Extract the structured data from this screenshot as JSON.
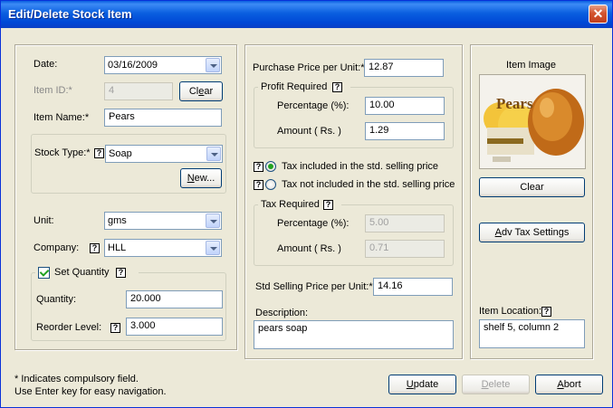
{
  "window": {
    "title": "Edit/Delete Stock Item",
    "close_label": "✕"
  },
  "left": {
    "date_label": "Date:",
    "date_value": "03/16/2009",
    "item_id_label": "Item ID:*",
    "item_id_value": "4",
    "clear_button": "Clear",
    "item_name_label": "Item Name:*",
    "item_name_value": "Pears",
    "stock_type_label": "Stock Type:*",
    "stock_type_value": "Soap",
    "new_button": "New...",
    "unit_label": "Unit:",
    "unit_value": "gms",
    "company_label": "Company:",
    "company_value": "HLL",
    "set_quantity_label": "Set Quantity",
    "quantity_label": "Quantity:",
    "quantity_value": "20.000",
    "reorder_label": "Reorder Level:",
    "reorder_value": "3.000"
  },
  "middle": {
    "purchase_label": "Purchase Price per Unit:*",
    "purchase_value": "12.87",
    "profit_title": "Profit Required",
    "profit_pct_label": "Percentage (%):",
    "profit_pct_value": "10.00",
    "profit_amt_label": "Amount ( Rs. )",
    "profit_amt_value": "1.29",
    "tax_included_label": "Tax included in the std. selling price",
    "tax_not_included_label": "Tax not included in the std. selling price",
    "tax_title": "Tax Required",
    "tax_pct_label": "Percentage (%):",
    "tax_pct_value": "5.00",
    "tax_amt_label": "Amount ( Rs. )",
    "tax_amt_value": "0.71",
    "std_price_label": "Std Selling Price per Unit:*",
    "std_price_value": "14.16",
    "description_label": "Description:",
    "description_value": "pears soap"
  },
  "right": {
    "image_label": "Item Image",
    "image_brand_text": "Pears",
    "clear_button": "Clear",
    "adv_tax_button": "Adv Tax Settings",
    "location_label": "Item Location:",
    "location_value": "shelf 5, column 2"
  },
  "footer": {
    "note1": "* Indicates compulsory field.",
    "note2": "Use Enter key for easy navigation.",
    "update_button": "Update",
    "delete_button": "Delete",
    "abort_button": "Abort"
  },
  "help_glyph": "?",
  "colors": {
    "titlebar": "#0A5FE0",
    "window_bg": "#ECE9D8",
    "close": "#D4552F"
  }
}
